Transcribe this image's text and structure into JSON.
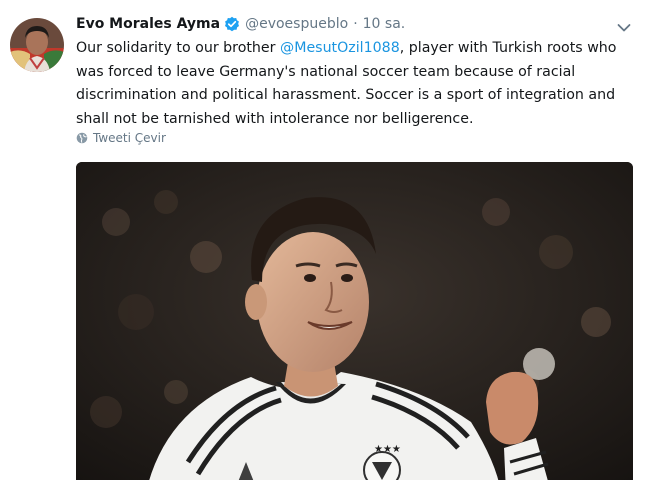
{
  "tweet": {
    "author_name": "Evo Morales Ayma",
    "handle": "@evoespueblo",
    "separator": "·",
    "time": "10 sa.",
    "text_before": "Our solidarity to our brother ",
    "mention": "@MesutOzil1088",
    "text_after": ", player with Turkish roots who was forced to leave Germany's national soccer team because of racial discrimination and political harassment. Soccer is a sport of integration and shall not be tarnished with intolerance nor belligerence.",
    "translate_label": "Tweeti Çevir"
  },
  "colors": {
    "link": "#1b95e0",
    "verified": "#1da1f2",
    "muted": "#657786"
  },
  "icons": [
    "verified-badge-icon",
    "chevron-down-icon",
    "globe-icon"
  ]
}
